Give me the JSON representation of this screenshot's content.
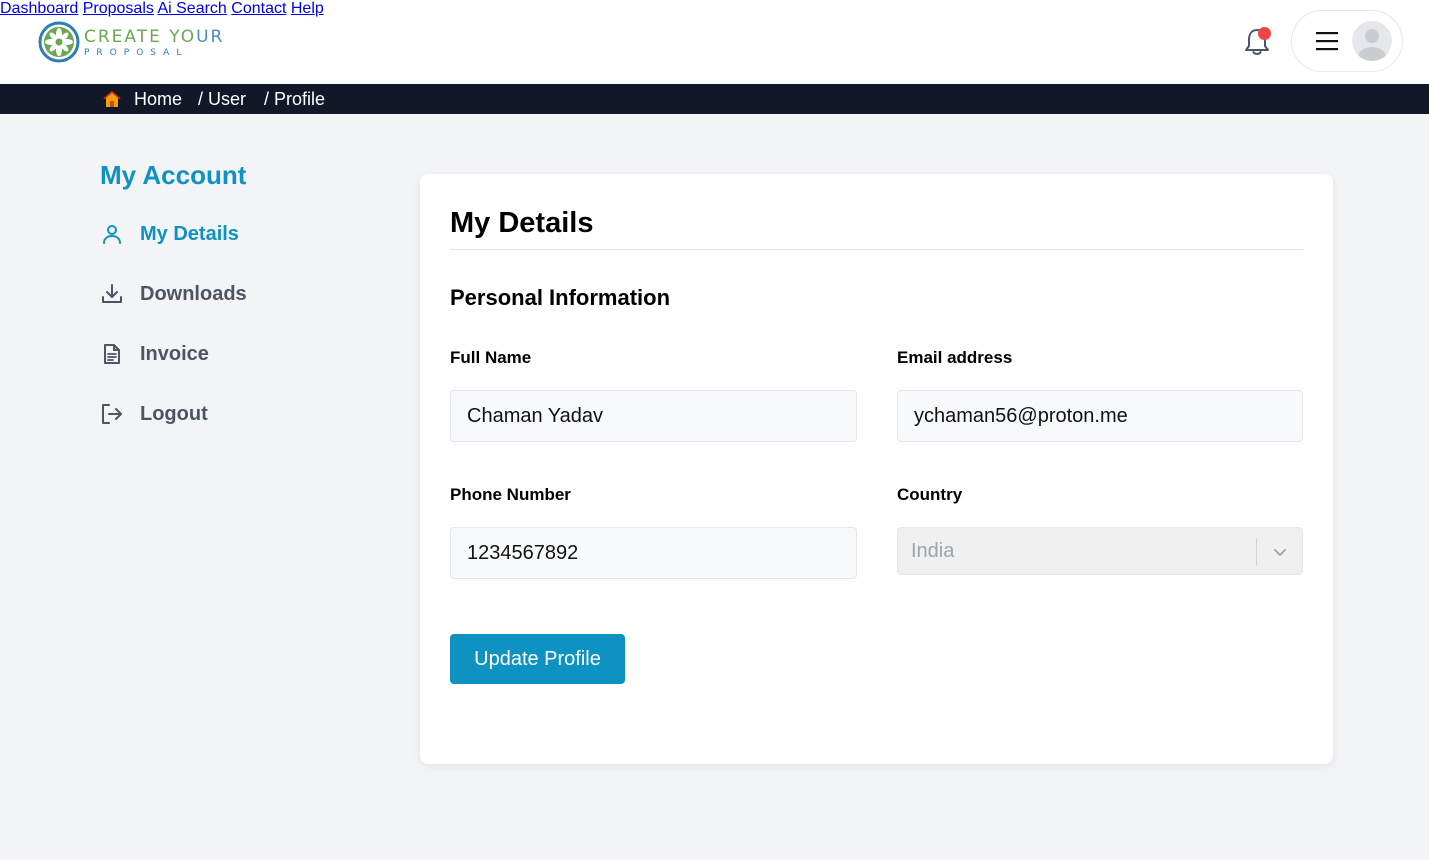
{
  "brand": {
    "name_line1_a": "CREATE YO",
    "name_line1_b": "UR",
    "name_line2": "PROPOSAL"
  },
  "nav": {
    "items": [
      "Dashboard",
      "Proposals",
      "Ai Search",
      "Contact",
      "Help"
    ]
  },
  "breadcrumb": {
    "home": "Home",
    "user": "/ User",
    "profile": "/ Profile"
  },
  "sidebar": {
    "title": "My Account",
    "items": [
      {
        "label": "My Details",
        "icon": "user-icon",
        "active": true
      },
      {
        "label": "Downloads",
        "icon": "download-icon",
        "active": false
      },
      {
        "label": "Invoice",
        "icon": "document-icon",
        "active": false
      },
      {
        "label": "Logout",
        "icon": "logout-icon",
        "active": false
      }
    ]
  },
  "main": {
    "title": "My Details",
    "section_title": "Personal Information",
    "full_name": {
      "label": "Full Name",
      "value": "Chaman Yadav"
    },
    "email": {
      "label": "Email address",
      "value": "ychaman56@proton.me"
    },
    "phone": {
      "label": "Phone Number",
      "value": "1234567892"
    },
    "country": {
      "label": "Country",
      "value": "India"
    },
    "submit_label": "Update Profile"
  },
  "colors": {
    "accent": "#0e92c1",
    "header_dark": "#111827",
    "notification_dot": "#ef4444",
    "background": "#f3f4f6"
  }
}
